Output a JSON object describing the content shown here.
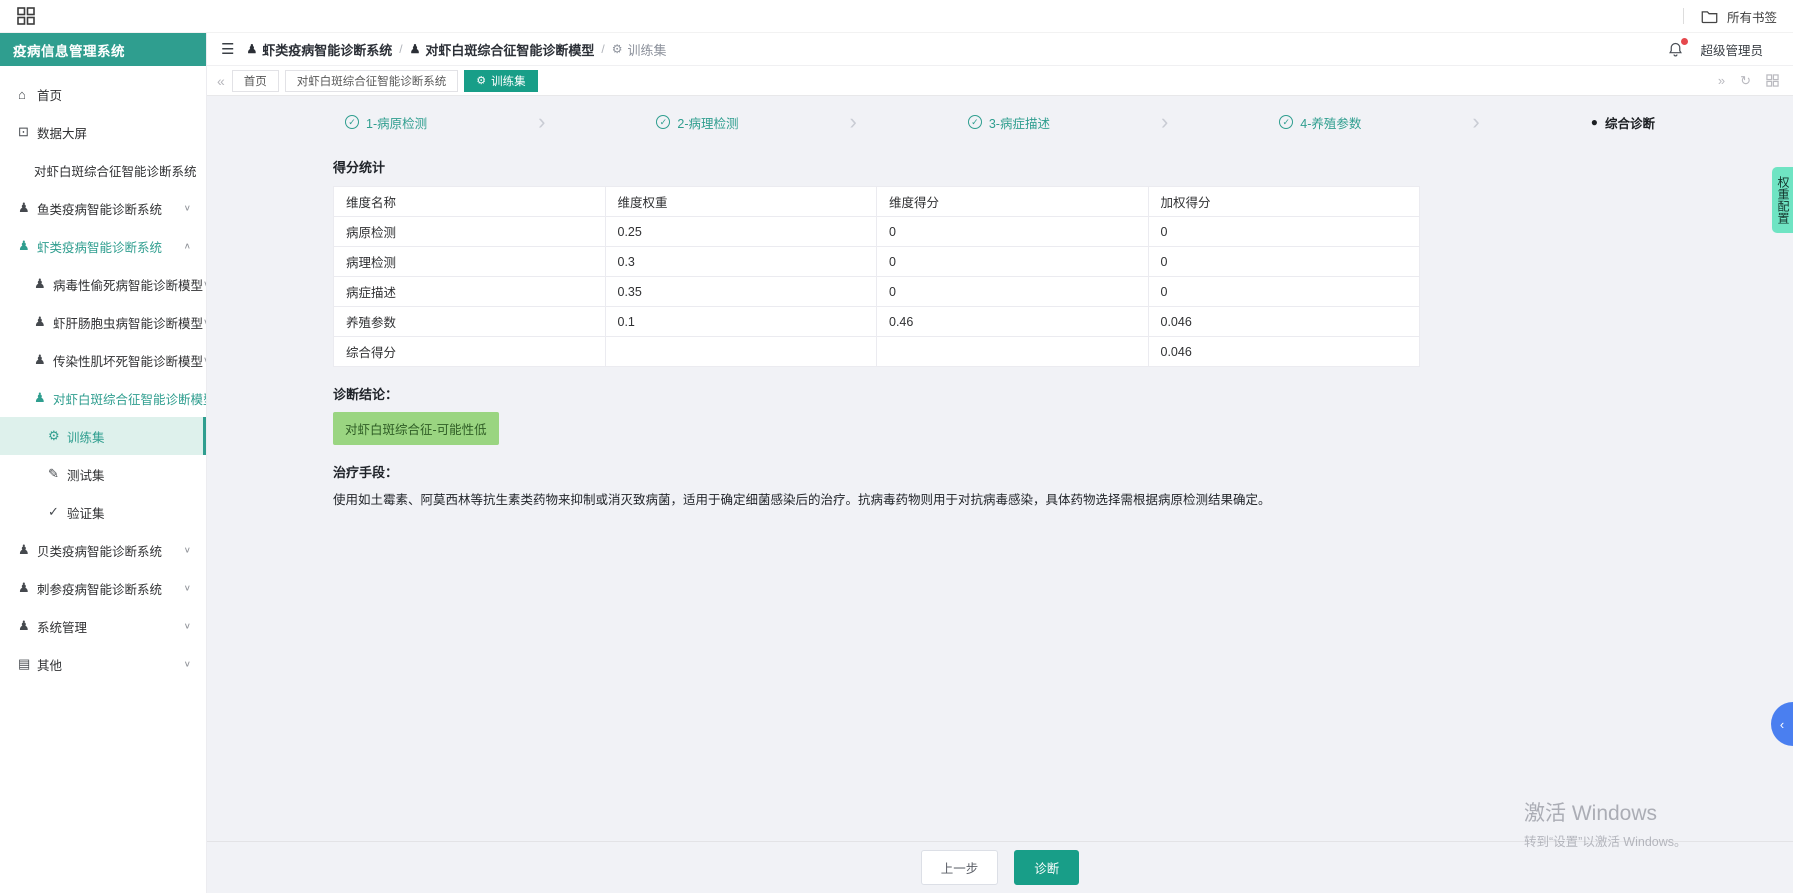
{
  "browser": {
    "bookmarks_label": "所有书签"
  },
  "header": {
    "breadcrumb": [
      {
        "icon": "module",
        "label": "虾类疫病智能诊断系统"
      },
      {
        "icon": "module",
        "label": "对虾白斑综合征智能诊断模型"
      },
      {
        "icon": "train",
        "label": "训练集"
      }
    ],
    "user": "超级管理员"
  },
  "sidebar": {
    "title": "疫病信息管理系统",
    "items": [
      {
        "label": "首页",
        "icon": "home",
        "level": 1,
        "chevron": null,
        "active": false,
        "highlight": false
      },
      {
        "label": "数据大屏",
        "icon": "screen",
        "level": 1,
        "chevron": null,
        "active": false,
        "highlight": false
      },
      {
        "label": "对虾白斑综合征智能诊断系统",
        "icon": null,
        "level": 2,
        "chevron": null,
        "active": false,
        "highlight": false
      },
      {
        "label": "鱼类疫病智能诊断系统",
        "icon": "module",
        "level": 1,
        "chevron": "down",
        "active": false,
        "highlight": false
      },
      {
        "label": "虾类疫病智能诊断系统",
        "icon": "module",
        "level": 1,
        "chevron": "up",
        "active": false,
        "highlight": true
      },
      {
        "label": "病毒性偷死病智能诊断模型",
        "icon": "module",
        "level": 2,
        "chevron": "down",
        "active": false,
        "highlight": false
      },
      {
        "label": "虾肝肠胞虫病智能诊断模型",
        "icon": "module",
        "level": 2,
        "chevron": "down",
        "active": false,
        "highlight": false
      },
      {
        "label": "传染性肌坏死智能诊断模型",
        "icon": "module",
        "level": 2,
        "chevron": "down",
        "active": false,
        "highlight": false
      },
      {
        "label": "对虾白斑综合征智能诊断模型",
        "icon": "module",
        "level": 2,
        "chevron": "up",
        "active": false,
        "highlight": true
      },
      {
        "label": "训练集",
        "icon": "train",
        "level": 3,
        "chevron": null,
        "active": true,
        "highlight": false
      },
      {
        "label": "测试集",
        "icon": "pencil",
        "level": 3,
        "chevron": null,
        "active": false,
        "highlight": false
      },
      {
        "label": "验证集",
        "icon": "check",
        "level": 3,
        "chevron": null,
        "active": false,
        "highlight": false
      },
      {
        "label": "贝类疫病智能诊断系统",
        "icon": "module",
        "level": 1,
        "chevron": "down",
        "active": false,
        "highlight": false
      },
      {
        "label": "刺参疫病智能诊断系统",
        "icon": "module",
        "level": 1,
        "chevron": "down",
        "active": false,
        "highlight": false
      },
      {
        "label": "系统管理",
        "icon": "user",
        "level": 1,
        "chevron": "down",
        "active": false,
        "highlight": false
      },
      {
        "label": "其他",
        "icon": "box",
        "level": 1,
        "chevron": "down",
        "active": false,
        "highlight": false
      }
    ]
  },
  "tabs": [
    {
      "label": "首页",
      "active": false,
      "icon": null
    },
    {
      "label": "对虾白斑综合征智能诊断系统",
      "active": false,
      "icon": null
    },
    {
      "label": "训练集",
      "active": true,
      "icon": "train"
    }
  ],
  "steps": [
    {
      "label": "1-病原检测",
      "state": "done"
    },
    {
      "label": "2-病理检测",
      "state": "done"
    },
    {
      "label": "3-病症描述",
      "state": "done"
    },
    {
      "label": "4-养殖参数",
      "state": "done"
    },
    {
      "label": "综合诊断",
      "state": "current"
    }
  ],
  "main": {
    "score_title": "得分统计",
    "table": {
      "headers": [
        "维度名称",
        "维度权重",
        "维度得分",
        "加权得分"
      ],
      "rows": [
        [
          "病原检测",
          "0.25",
          "0",
          "0"
        ],
        [
          "病理检测",
          "0.3",
          "0",
          "0"
        ],
        [
          "病症描述",
          "0.35",
          "0",
          "0"
        ],
        [
          "养殖参数",
          "0.1",
          "0.46",
          "0.046"
        ],
        [
          "综合得分",
          "",
          "",
          "0.046"
        ]
      ]
    },
    "conclusion_label": "诊断结论：",
    "conclusion_badge": "对虾白斑综合征-可能性低",
    "treatment_label": "治疗手段：",
    "treatment_text": "使用如土霉素、阿莫西林等抗生素类药物来抑制或消灭致病菌，适用于确定细菌感染后的治疗。抗病毒药物则用于对抗病毒感染，具体药物选择需根据病原检测结果确定。",
    "footer": {
      "prev_label": "上一步",
      "diagnose_label": "诊断"
    }
  },
  "right_edge": {
    "weight_config_label": "权重配置"
  },
  "watermark": {
    "line1": "激活 Windows",
    "line2": "转到“设置”以激活 Windows。"
  },
  "icons": {
    "hamburger": "☰",
    "collapse": "«",
    "expand": "»",
    "refresh": "↻",
    "step_arrow": "›",
    "drawer": "‹",
    "dot": "●",
    "check_mark": "✓",
    "home": "⌂",
    "screen": "⊡",
    "module": "♟",
    "pencil": "✎",
    "check": "✓",
    "train": "⚙",
    "user": "♟",
    "box": "▤",
    "chev_down": "∨",
    "chev_up": "∧"
  },
  "colors": {
    "primary": "#2f9e8f",
    "tab_active": "#189e88",
    "badge_bg": "#9ad581",
    "badge_text": "#2f5d25",
    "mint": "#6fe4c3",
    "blue": "#4a7ff0",
    "red": "#e5484d",
    "sidebar_active_bg": "#def1ec"
  }
}
